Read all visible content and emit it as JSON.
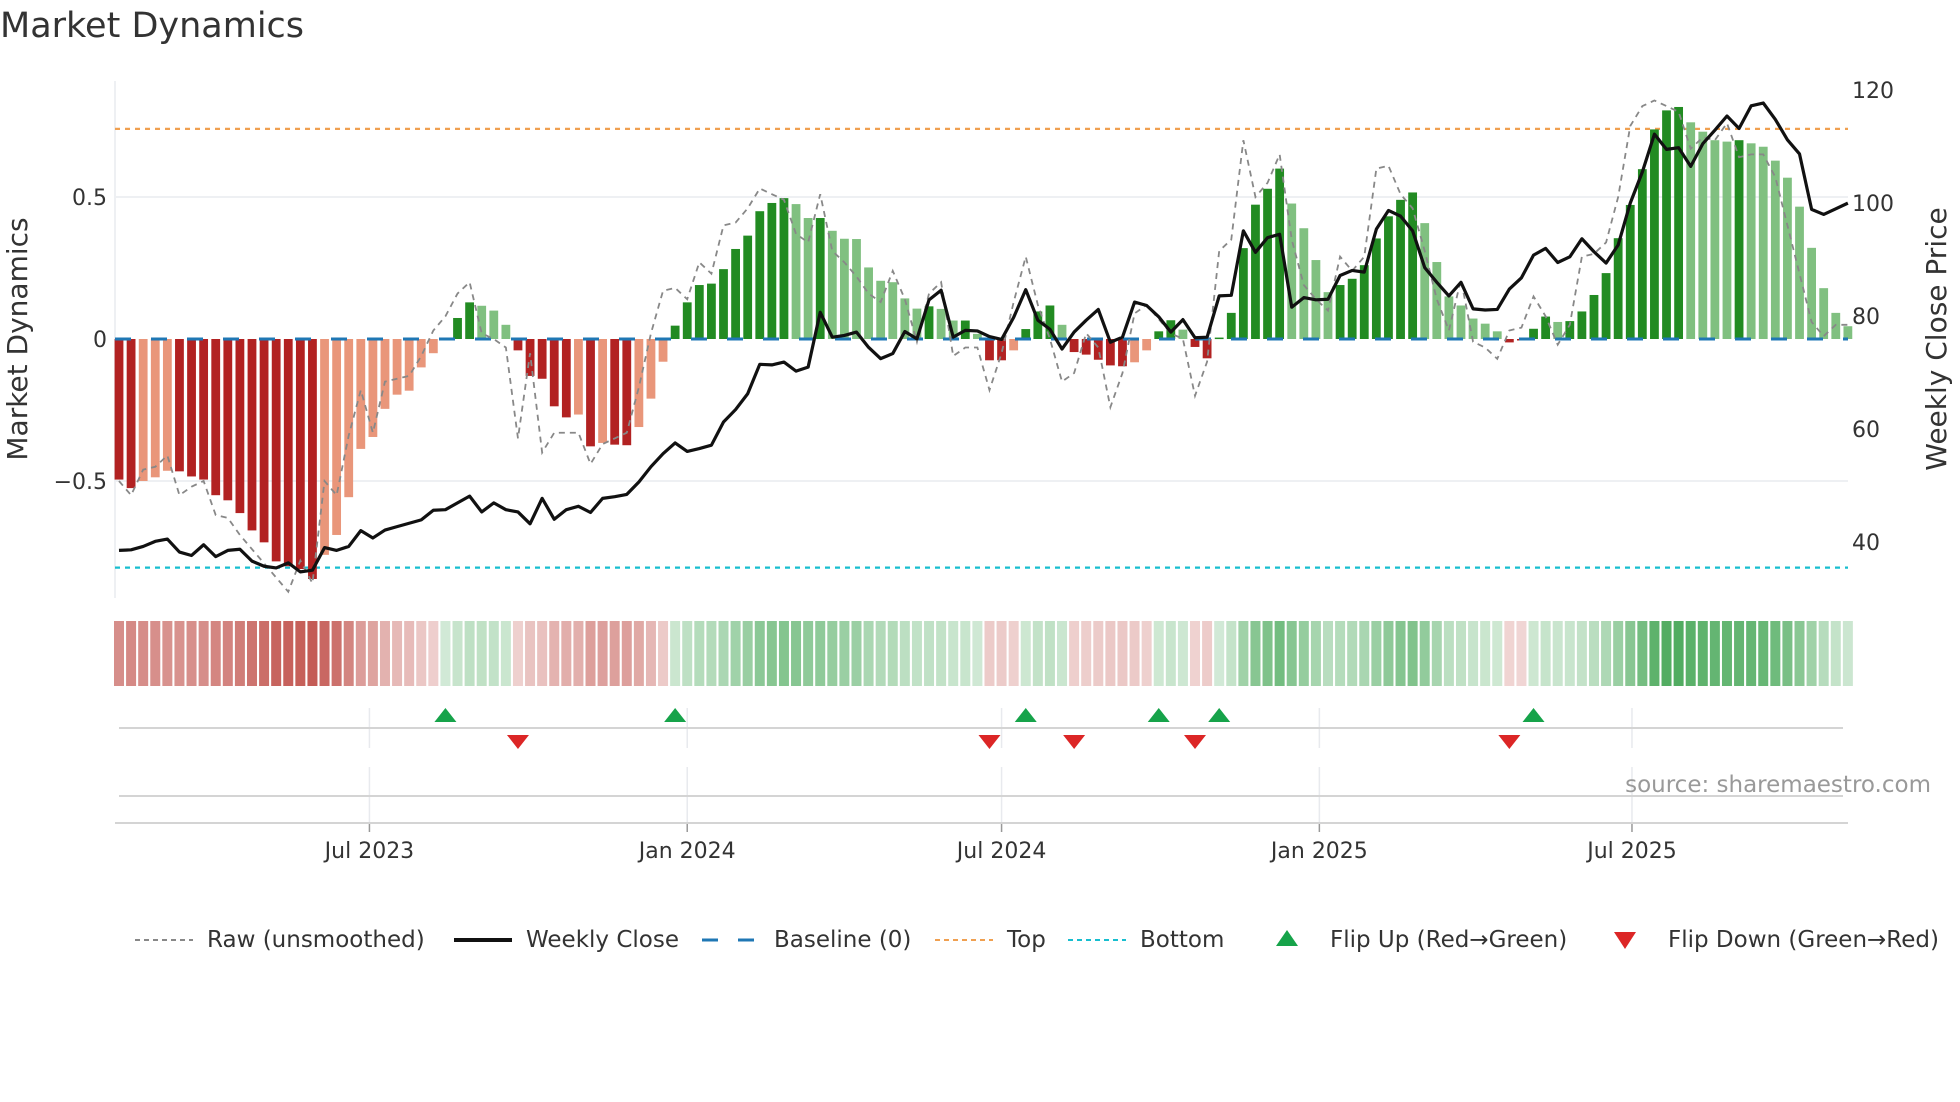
{
  "title": "Market Dynamics",
  "source": "source: sharemaestro.com",
  "chart_data": {
    "type": "bar",
    "title": "Market Dynamics",
    "ylabel": "Market Dynamics",
    "y2label": "Weekly Close Price",
    "x_start": "2023-02-06",
    "x_step": "weekly",
    "ylim": [
      -0.912,
      0.908
    ],
    "y2lim": [
      30.2,
      121.6
    ],
    "yticks": [
      {
        "v": 0.5,
        "label": "0.5"
      },
      {
        "v": 0,
        "label": "0"
      },
      {
        "v": -0.5,
        "label": "−0.5"
      }
    ],
    "y2ticks": [
      {
        "v": 120,
        "label": "120"
      },
      {
        "v": 100,
        "label": "100"
      },
      {
        "v": 80,
        "label": "80"
      },
      {
        "v": 60,
        "label": "60"
      },
      {
        "v": 40,
        "label": "40"
      }
    ],
    "xticks": [
      {
        "date": "2023-07-01",
        "label": "Jul 2023"
      },
      {
        "date": "2024-01-01",
        "label": "Jan 2024"
      },
      {
        "date": "2024-07-01",
        "label": "Jul 2024"
      },
      {
        "date": "2025-01-01",
        "label": "Jan 2025"
      },
      {
        "date": "2025-07-01",
        "label": "Jul 2025"
      }
    ],
    "top_level": 0.74,
    "bottom_level": -0.805,
    "baseline": 0,
    "grid": true,
    "legend_position": "bottom",
    "momentum": [
      -0.495,
      -0.525,
      -0.5,
      -0.487,
      -0.464,
      -0.466,
      -0.484,
      -0.495,
      -0.55,
      -0.568,
      -0.613,
      -0.674,
      -0.716,
      -0.783,
      -0.8,
      -0.81,
      -0.845,
      -0.76,
      -0.69,
      -0.557,
      -0.387,
      -0.345,
      -0.246,
      -0.196,
      -0.182,
      -0.1,
      -0.05,
      0.005,
      0.074,
      0.129,
      0.117,
      0.1,
      0.05,
      -0.04,
      -0.13,
      -0.14,
      -0.237,
      -0.276,
      -0.266,
      -0.378,
      -0.366,
      -0.372,
      -0.374,
      -0.31,
      -0.21,
      -0.08,
      0.047,
      0.129,
      0.19,
      0.195,
      0.246,
      0.317,
      0.364,
      0.45,
      0.479,
      0.496,
      0.475,
      0.426,
      0.426,
      0.381,
      0.353,
      0.352,
      0.252,
      0.205,
      0.2,
      0.143,
      0.107,
      0.115,
      0.106,
      0.065,
      0.065,
      0.018,
      -0.075,
      -0.075,
      -0.04,
      0.035,
      0.097,
      0.118,
      0.05,
      -0.046,
      -0.055,
      -0.073,
      -0.093,
      -0.096,
      -0.082,
      -0.04,
      0.027,
      0.066,
      0.033,
      -0.028,
      -0.068,
      0.005,
      0.092,
      0.32,
      0.473,
      0.529,
      0.6,
      0.477,
      0.39,
      0.278,
      0.165,
      0.19,
      0.212,
      0.26,
      0.354,
      0.432,
      0.49,
      0.516,
      0.408,
      0.271,
      0.15,
      0.118,
      0.072,
      0.054,
      0.027,
      -0.012,
      -0.003,
      0.036,
      0.079,
      0.06,
      0.063,
      0.097,
      0.155,
      0.232,
      0.355,
      0.472,
      0.598,
      0.738,
      0.805,
      0.817,
      0.763,
      0.73,
      0.7,
      0.695,
      0.7,
      0.689,
      0.677,
      0.628,
      0.568,
      0.466,
      0.321,
      0.179,
      0.092,
      0.045
    ],
    "shade_runs": [
      "RR",
      "rrr",
      "RRRRRRRRRRRR",
      "rrrrrrrrrr",
      "GGG",
      "ggg",
      "RRRRR",
      "r",
      "R",
      "r",
      "RR",
      "rrr",
      "GGGGGGGGGG",
      "gg",
      "G",
      "gggggggg",
      "G",
      "gg",
      "G",
      "g",
      "RR",
      "r",
      "GGG",
      "g",
      "RRRRR",
      "rr",
      "GG",
      "g",
      "RR",
      "GGGGGG",
      "gggg",
      "GGGGGGG",
      "ggggggg",
      "RR",
      "GG",
      "g",
      "GGGGGGGGGG",
      "gggg",
      "G",
      "ggggggggg"
    ],
    "raw": [
      -0.5,
      -0.55,
      -0.46,
      -0.45,
      -0.41,
      -0.55,
      -0.52,
      -0.5,
      -0.62,
      -0.63,
      -0.69,
      -0.74,
      -0.79,
      -0.84,
      -0.89,
      -0.78,
      -0.86,
      -0.5,
      -0.55,
      -0.34,
      -0.18,
      -0.33,
      -0.15,
      -0.14,
      -0.13,
      -0.06,
      0.03,
      0.08,
      0.16,
      0.2,
      0.02,
      0.0,
      -0.03,
      -0.35,
      -0.05,
      -0.4,
      -0.33,
      -0.33,
      -0.33,
      -0.44,
      -0.37,
      -0.35,
      -0.33,
      -0.17,
      0.02,
      0.17,
      0.18,
      0.14,
      0.27,
      0.23,
      0.4,
      0.41,
      0.46,
      0.53,
      0.51,
      0.49,
      0.37,
      0.34,
      0.51,
      0.31,
      0.27,
      0.22,
      0.16,
      0.13,
      0.24,
      0.14,
      -0.01,
      0.16,
      0.2,
      -0.06,
      -0.03,
      -0.03,
      -0.18,
      -0.05,
      0.13,
      0.29,
      0.12,
      0.0,
      -0.15,
      -0.12,
      0.02,
      -0.03,
      -0.24,
      -0.12,
      0.09,
      0.12,
      0.07,
      0.02,
      0.0,
      -0.2,
      -0.08,
      0.31,
      0.35,
      0.7,
      0.5,
      0.55,
      0.65,
      0.35,
      0.19,
      0.14,
      0.1,
      0.29,
      0.24,
      0.29,
      0.6,
      0.61,
      0.51,
      0.46,
      0.31,
      0.14,
      0.03,
      0.21,
      -0.01,
      -0.03,
      -0.07,
      0.03,
      0.04,
      0.15,
      0.08,
      -0.02,
      0.05,
      0.29,
      0.3,
      0.34,
      0.5,
      0.75,
      0.82,
      0.84,
      0.82,
      0.8,
      0.67,
      0.71,
      0.7,
      0.76,
      0.64,
      0.65,
      0.65,
      0.57,
      0.4,
      0.23,
      0.06,
      0.01,
      0.05,
      0.05
    ],
    "weekly_close": [
      38.6,
      38.7,
      39.3,
      40.2,
      40.6,
      38.3,
      37.7,
      39.6,
      37.5,
      38.6,
      38.8,
      36.7,
      35.8,
      35.5,
      36.4,
      34.8,
      35.1,
      39.1,
      38.6,
      39.3,
      42.1,
      40.8,
      42.2,
      42.8,
      43.4,
      44.0,
      45.7,
      45.8,
      47.0,
      48.2,
      45.4,
      47.0,
      45.8,
      45.4,
      43.3,
      47.8,
      44.1,
      45.8,
      46.4,
      45.3,
      47.8,
      48.1,
      48.5,
      50.7,
      53.4,
      55.7,
      57.6,
      56.1,
      56.6,
      57.2,
      61.3,
      63.5,
      66.3,
      71.5,
      71.4,
      71.9,
      70.3,
      71.0,
      80.7,
      76.3,
      76.6,
      77.2,
      74.5,
      72.5,
      73.4,
      77.3,
      76.0,
      82.9,
      84.6,
      76.3,
      77.5,
      77.4,
      76.4,
      75.9,
      79.8,
      84.7,
      79.3,
      77.7,
      74.2,
      77.2,
      79.3,
      81.2,
      75.4,
      76.3,
      82.5,
      81.9,
      79.9,
      77.2,
      79.4,
      76.2,
      76.3,
      83.6,
      83.7,
      95.1,
      91.3,
      93.9,
      94.5,
      81.6,
      83.3,
      82.9,
      83.0,
      87.2,
      88.1,
      87.8,
      95.4,
      98.7,
      97.7,
      95.1,
      88.6,
      86.0,
      83.6,
      86.0,
      81.3,
      81.1,
      81.2,
      84.8,
      86.8,
      90.8,
      92.0,
      89.5,
      90.5,
      93.7,
      91.4,
      89.4,
      92.6,
      100.0,
      105.5,
      112.2,
      109.5,
      109.8,
      106.5,
      110.5,
      112.9,
      115.4,
      113.2,
      117.2,
      117.7,
      114.8,
      111.2,
      108.7,
      98.9,
      98.0,
      99.0,
      100.0
    ],
    "flip_up_weeks": [
      28,
      47,
      76,
      87,
      92,
      118
    ],
    "flip_down_weeks": [
      34,
      73,
      80,
      90,
      116
    ],
    "legend": [
      {
        "key": "raw",
        "label": "Raw (unsmoothed)"
      },
      {
        "key": "close",
        "label": "Weekly Close"
      },
      {
        "key": "baseline",
        "label": "Baseline (0)"
      },
      {
        "key": "top",
        "label": "Top"
      },
      {
        "key": "bottom",
        "label": "Bottom"
      },
      {
        "key": "flip_up",
        "label": "Flip Up (Red→Green)"
      },
      {
        "key": "flip_down",
        "label": "Flip Down (Green→Red)"
      }
    ],
    "colors": {
      "strong_red": "#b22222",
      "weak_red": "#e9967a",
      "strong_green": "#228b22",
      "weak_green": "#80c080",
      "raw": "#888888",
      "close": "#111111",
      "baseline": "#1f77b4",
      "top": "#f0a050",
      "bottom": "#17becf",
      "flip_up": "#16a34a",
      "flip_down": "#dc2626"
    }
  }
}
